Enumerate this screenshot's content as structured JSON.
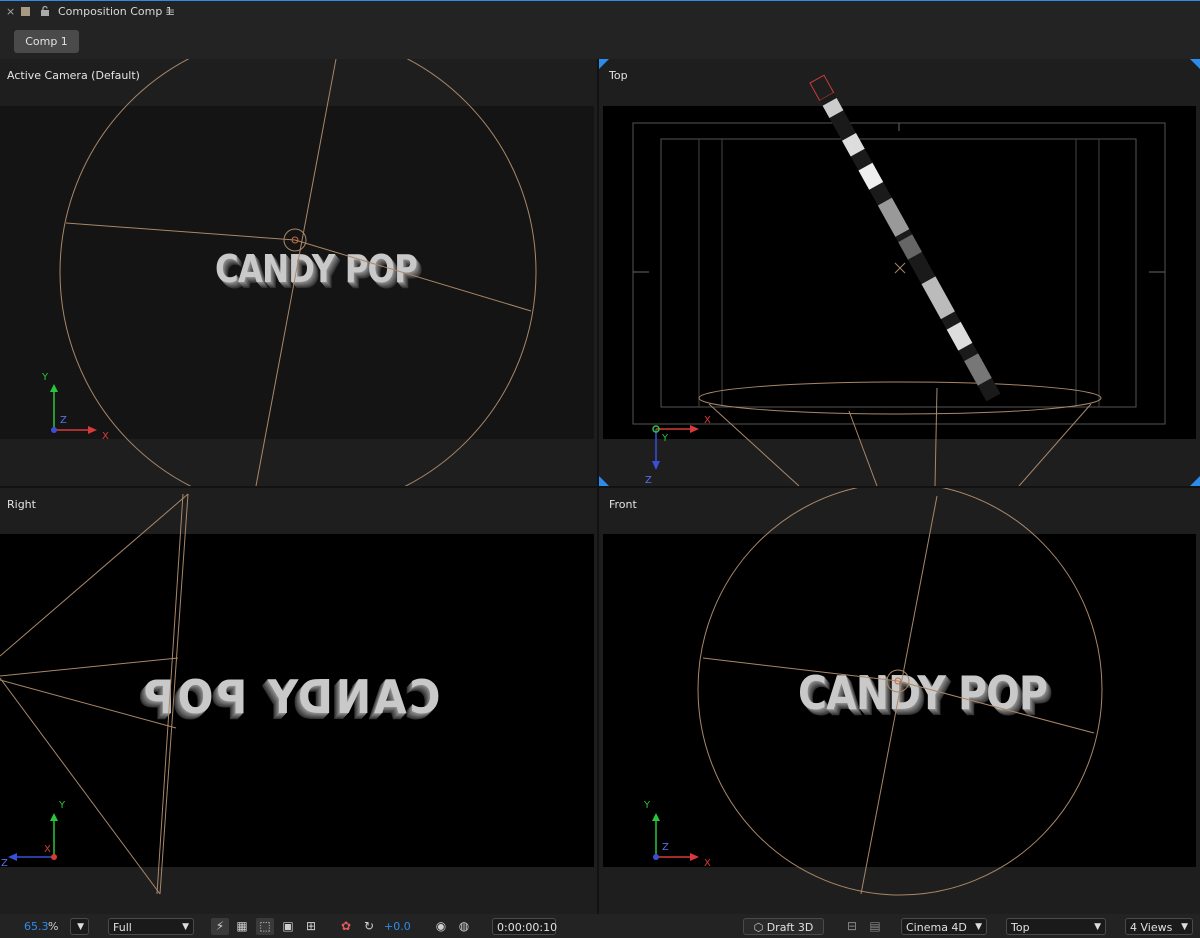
{
  "panel": {
    "close_glyph": "×",
    "title": "Composition Comp 1",
    "menu_glyph": "≡",
    "swatch_color": "#a69a84",
    "accent_color": "#2d8ceb"
  },
  "comp_tab": "Comp 1",
  "viewports": {
    "active_camera": {
      "label": "Active Camera (Default)",
      "text": "CANDY POP"
    },
    "top": {
      "label": "Top"
    },
    "right": {
      "label": "Right",
      "text": "POP YDNAC"
    },
    "front": {
      "label": "Front",
      "text": "CANDY POP"
    }
  },
  "axes": {
    "x": "X",
    "y": "Y",
    "z": "Z"
  },
  "toolbar": {
    "zoom_value": "65.3",
    "zoom_unit": "%",
    "resolution": "Full",
    "exposure": "+0.0",
    "timecode": "0:00:00:10",
    "draft3d": "Draft 3D",
    "renderer": "Cinema 4D",
    "view": "Top",
    "layout": "4 Views",
    "icons": [
      "fast-previews-icon",
      "transparency-grid-icon",
      "region-of-interest-icon",
      "mask-visibility-icon",
      "guides-icon",
      "color-channels-icon",
      "reset-exposure-icon",
      "snapshot-icon",
      "show-snapshot-icon",
      "view-grid-icon",
      "extended-viewer-icon"
    ]
  }
}
